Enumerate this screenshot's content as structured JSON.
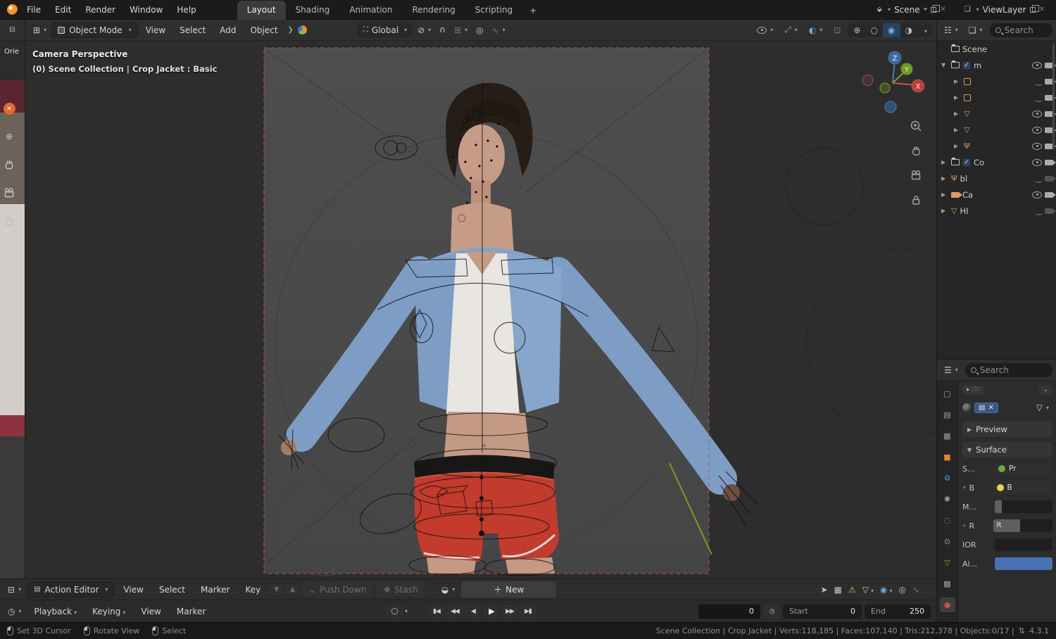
{
  "topbar": {
    "menus": [
      "File",
      "Edit",
      "Render",
      "Window",
      "Help"
    ],
    "tabs": [
      "Layout",
      "Shading",
      "Animation",
      "Rendering",
      "Scripting"
    ],
    "tab_add": "+",
    "scene_label": "Scene",
    "viewlayer_label": "ViewLayer"
  },
  "tool_header": {
    "mode": "Object Mode",
    "menus": [
      "View",
      "Select",
      "Add",
      "Object"
    ],
    "orientation": "Global"
  },
  "left_strip": {
    "label": "Orie"
  },
  "viewport": {
    "title": "Camera Perspective",
    "subtitle": "(0) Scene Collection | Crop Jacket : Basic",
    "axis_x": "X",
    "axis_y": "Y",
    "axis_z": "Z"
  },
  "outliner": {
    "search_placeholder": "Search",
    "root_label": "Scene",
    "items": [
      {
        "label": "m"
      },
      {
        "label": ""
      },
      {
        "label": ""
      },
      {
        "label": ""
      },
      {
        "label": ""
      },
      {
        "label": ""
      },
      {
        "label": "Co"
      },
      {
        "label": "bl"
      },
      {
        "label": "Ca"
      },
      {
        "label": "HI"
      }
    ]
  },
  "properties": {
    "search_placeholder": "Search",
    "preview_label": "Preview",
    "surface_label": "Surface",
    "rows": [
      {
        "label": "S...",
        "value": "Pr"
      },
      {
        "label": "B",
        "value": "B"
      },
      {
        "label": "M...",
        "value": ""
      },
      {
        "label": "R",
        "value": "R"
      },
      {
        "label": "IOR",
        "value": ""
      },
      {
        "label": "Al...",
        "value": ""
      }
    ]
  },
  "dopesheet": {
    "editor_label": "Action Editor",
    "menus": [
      "View",
      "Select",
      "Marker",
      "Key"
    ],
    "push_down": "Push Down",
    "stash": "Stash",
    "new_label": "New"
  },
  "timeline": {
    "playback_label": "Playback",
    "keying_label": "Keying",
    "menus": [
      "View",
      "Marker"
    ],
    "frame": "0",
    "start_label": "Start",
    "start_value": "0",
    "end_label": "End",
    "end_value": "250"
  },
  "statusbar": {
    "hints": [
      "Set 3D Cursor",
      "Rotate View",
      "Select"
    ],
    "stats": "Scene Collection | Crop Jacket | Verts:118,185 | Faces:107,140 | Tris:212,378 | Objects:0/17 |",
    "version": "4.3.1"
  }
}
